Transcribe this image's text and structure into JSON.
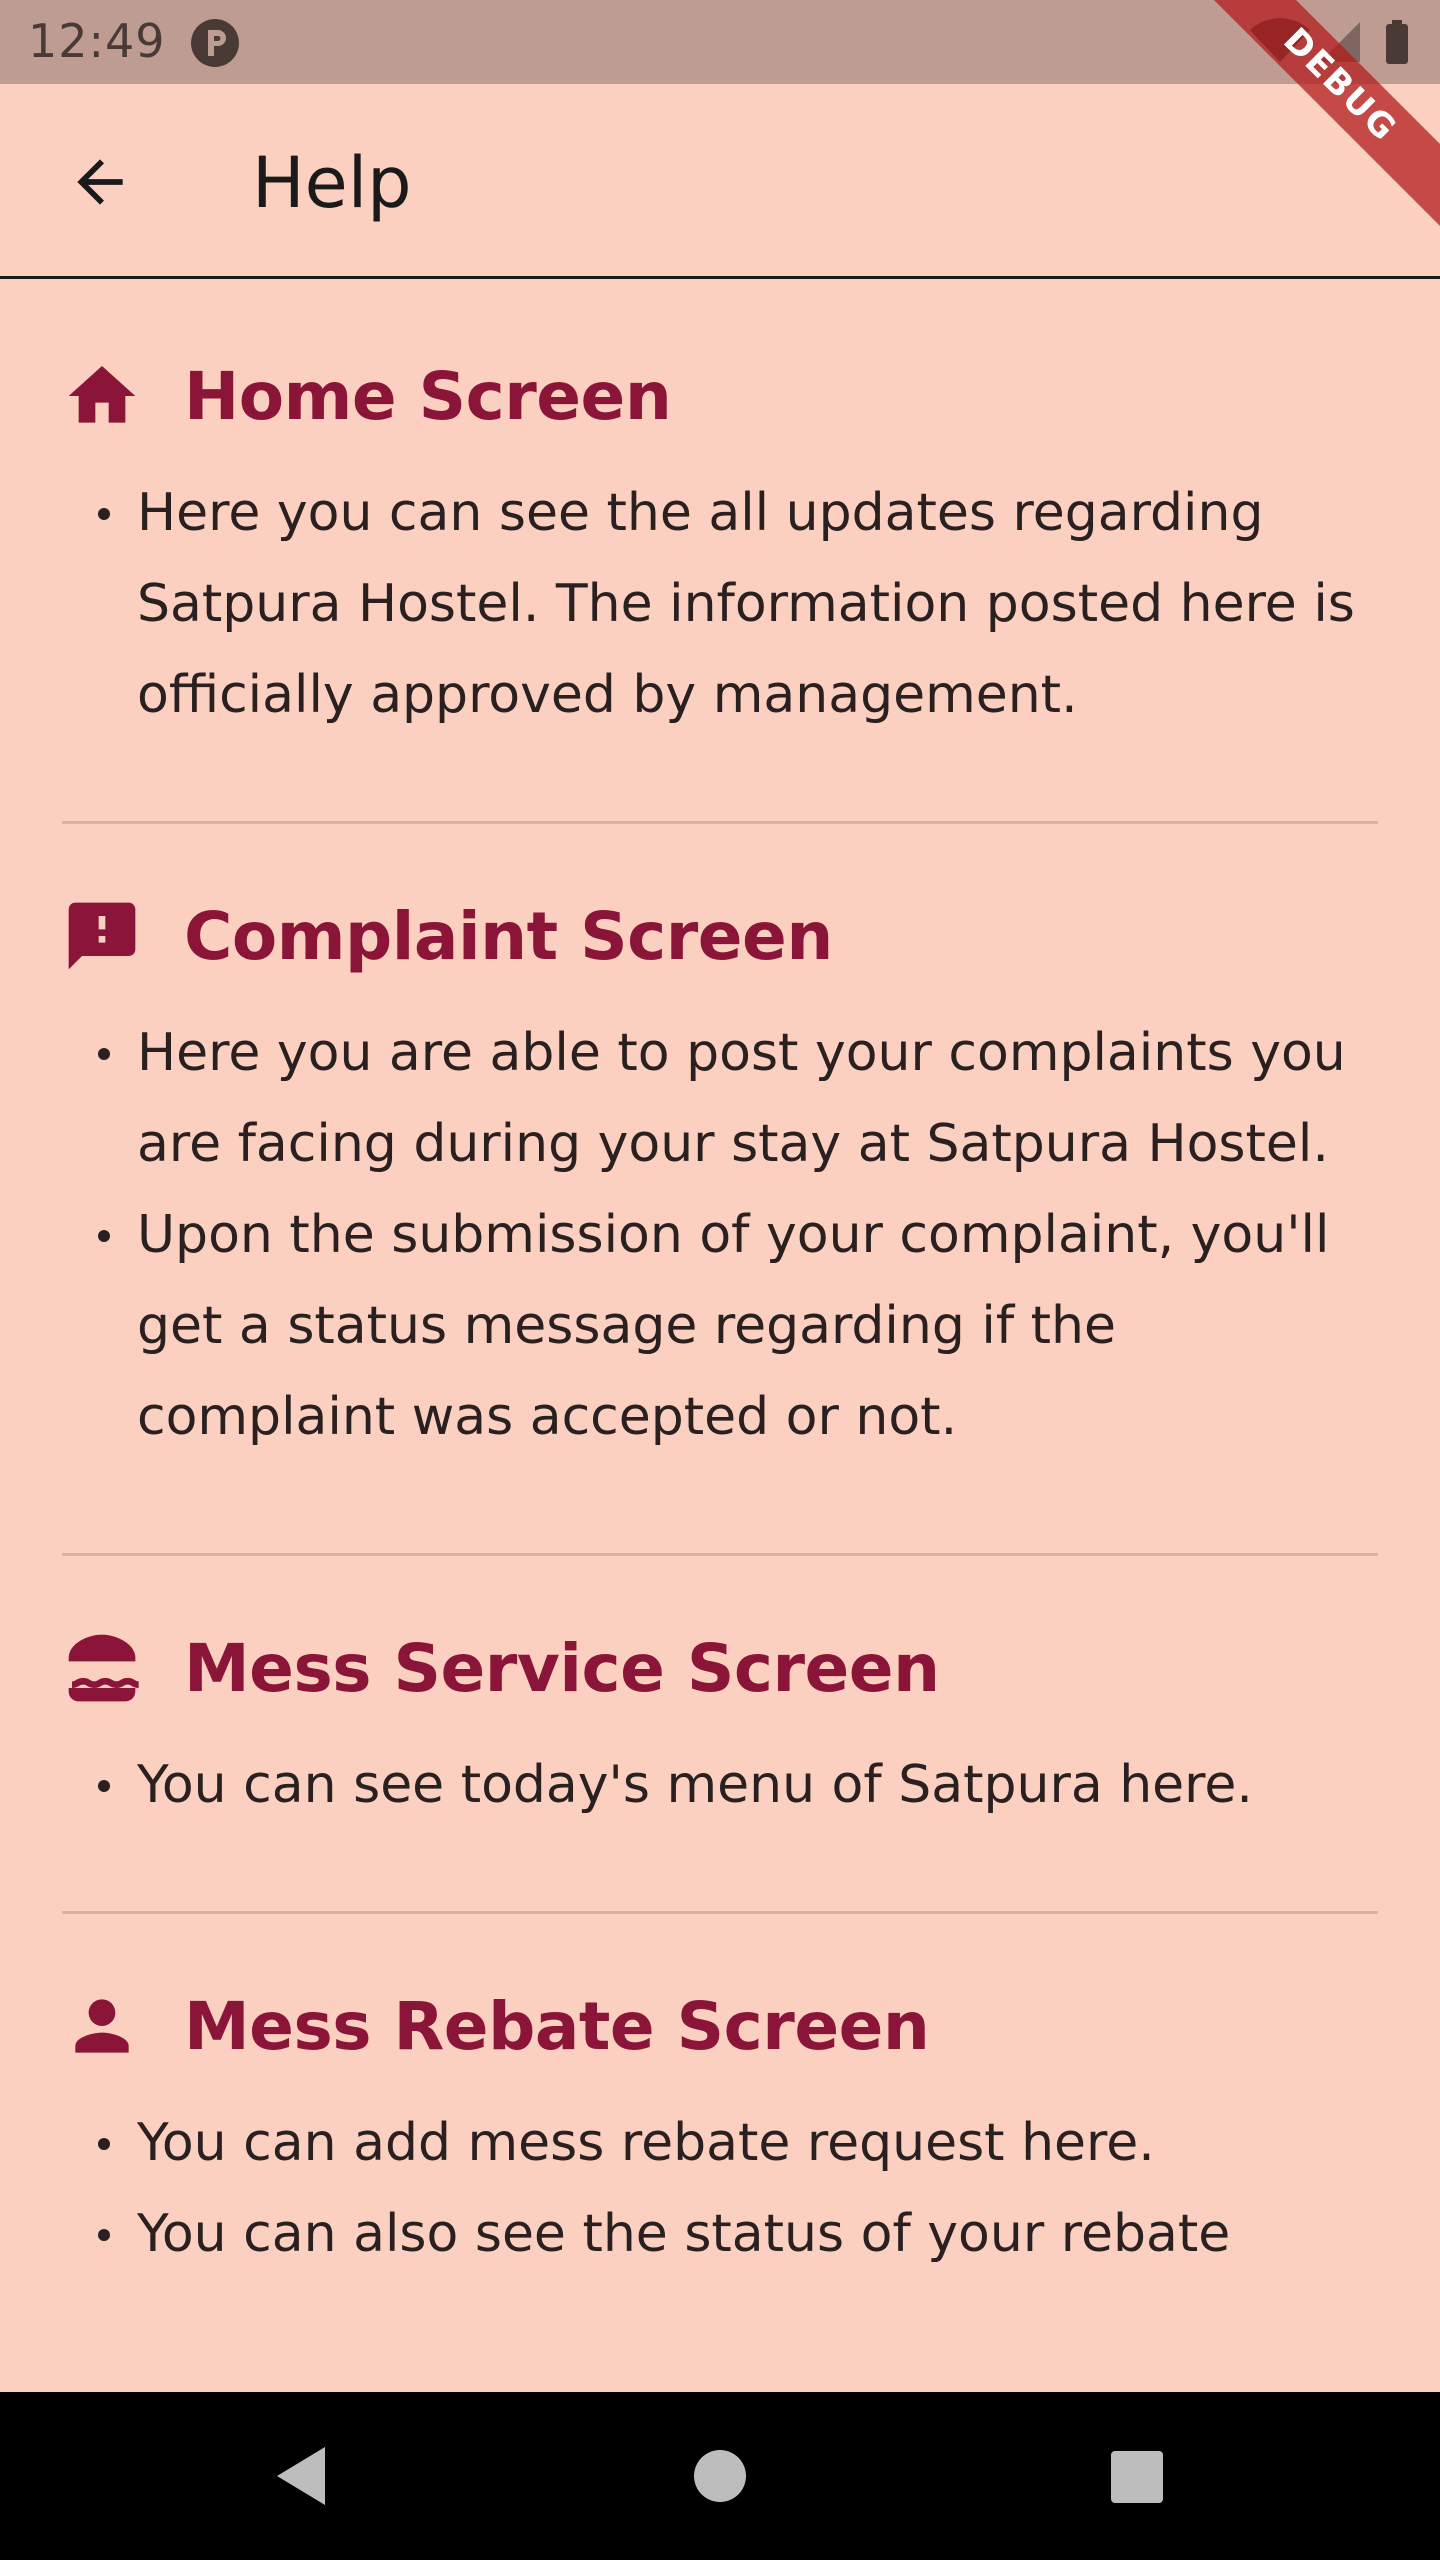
{
  "status_bar": {
    "time": "12:49"
  },
  "debug_banner": {
    "label": "DEBUG"
  },
  "app_bar": {
    "title": "Help",
    "back_icon": "arrow-back-icon"
  },
  "sections": [
    {
      "icon": "home-icon",
      "title": "Home Screen",
      "bullets": [
        "Here you can see the all updates regarding Satpura Hostel. The information posted here is officially approved by management."
      ]
    },
    {
      "icon": "feedback-icon",
      "title": "Complaint Screen",
      "bullets": [
        "Here you are able to post your complaints you are facing during your stay at Satpura Hostel.",
        "Upon the submission of your complaint, you'll get a status message regarding if the complaint was accepted or not."
      ]
    },
    {
      "icon": "lunch-icon",
      "title": "Mess Service Screen",
      "bullets": [
        "You can see today's menu of Satpura here."
      ]
    },
    {
      "icon": "person-icon",
      "title": "Mess Rebate Screen",
      "bullets": [
        "You can add mess rebate request here.",
        "You can also see the status of your rebate"
      ]
    }
  ],
  "colors": {
    "background": "#fbd0c0",
    "accent": "#8b1538",
    "status_bar": "#bf9c92"
  }
}
